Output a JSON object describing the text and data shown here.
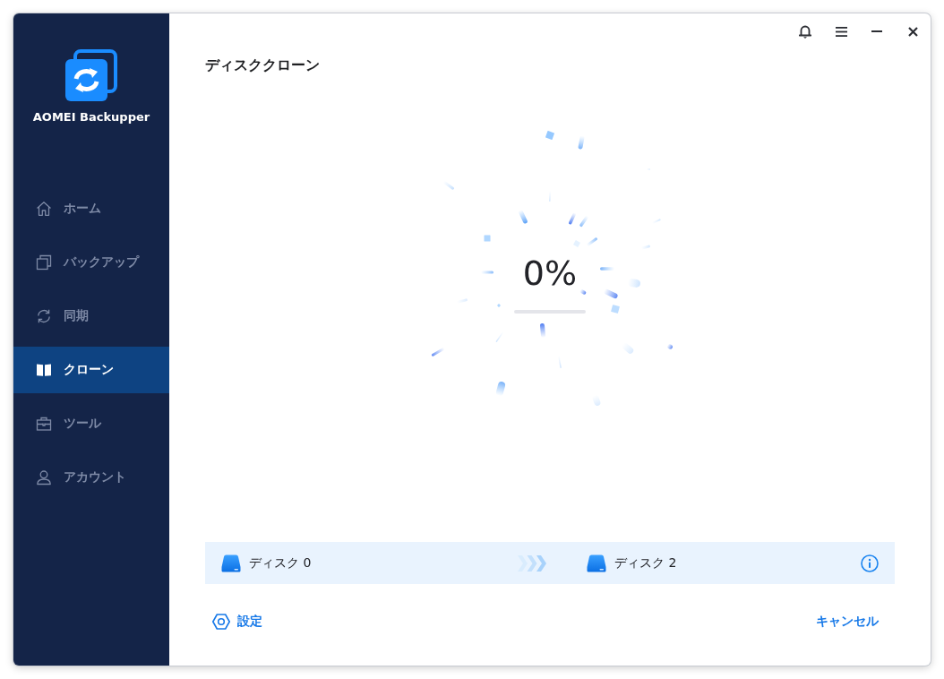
{
  "app": {
    "name": "AOMEI Backupper"
  },
  "sidebar": {
    "items": [
      {
        "label": "ホーム",
        "selected": false
      },
      {
        "label": "バックアップ",
        "selected": false
      },
      {
        "label": "同期",
        "selected": false
      },
      {
        "label": "クローン",
        "selected": true
      },
      {
        "label": "ツール",
        "selected": false
      },
      {
        "label": "アカウント",
        "selected": false
      }
    ]
  },
  "page": {
    "title": "ディスククローン"
  },
  "progress": {
    "percent": "0%",
    "level": 0
  },
  "clone_route": {
    "source": "ディスク 0",
    "target": "ディスク 2"
  },
  "footer": {
    "settings_button": "設定",
    "cancel_button": "キャンセル"
  }
}
